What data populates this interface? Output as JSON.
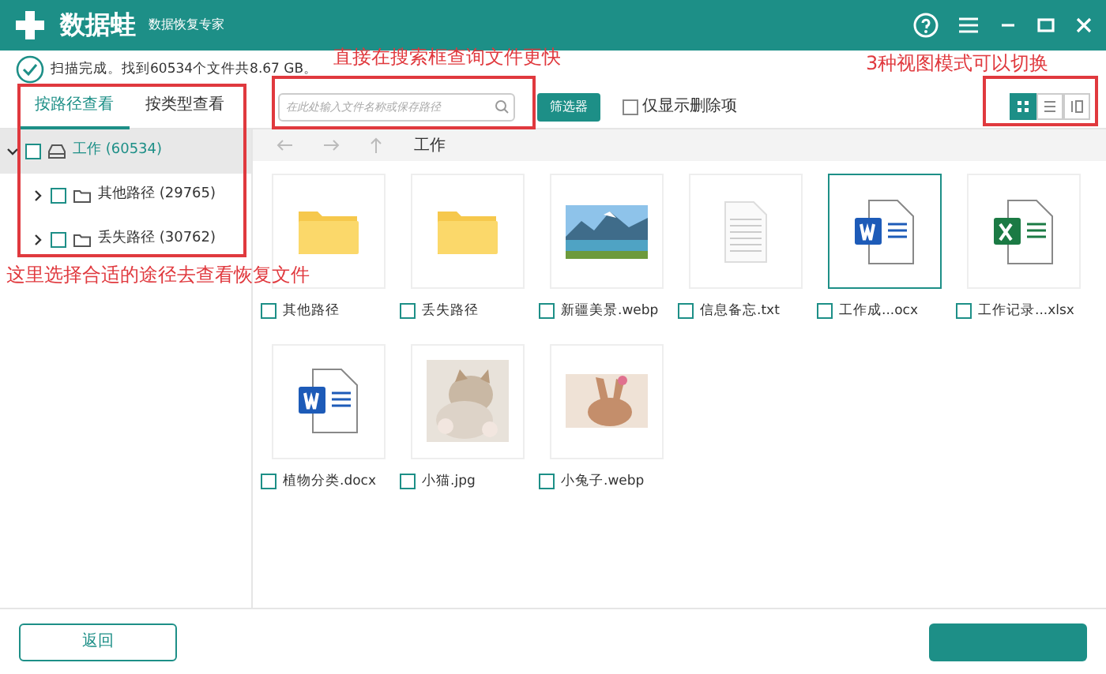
{
  "app": {
    "name": "数据蛙",
    "subtitle": "数据恢复专家"
  },
  "status": "扫描完成。找到60534个文件共8.67 GB。",
  "view_tabs": [
    {
      "label": "按路径查看",
      "selected": true
    },
    {
      "label": "按类型查看",
      "selected": false
    }
  ],
  "search": {
    "placeholder": "在此处输入文件名称或保存路径"
  },
  "filter_button": "筛选器",
  "deleted_only": {
    "label": "仅显示删除项",
    "checked": false
  },
  "view_modes": [
    {
      "kind": "grid",
      "selected": true
    },
    {
      "kind": "list",
      "selected": false
    },
    {
      "kind": "detail",
      "selected": false
    }
  ],
  "tree": [
    {
      "label": "工作 (60534)",
      "kind": "drive",
      "checked": false,
      "expanded": true,
      "selected": true,
      "children": [
        {
          "label": "其他路径 (29765)",
          "kind": "folder",
          "checked": false,
          "expanded": false,
          "selected": false
        },
        {
          "label": "丢失路径 (30762)",
          "kind": "folder",
          "checked": false,
          "expanded": false,
          "selected": false
        }
      ]
    }
  ],
  "breadcrumb": "工作",
  "files": [
    {
      "name": "其他路径",
      "kind": "folder",
      "checked": false,
      "selected": false
    },
    {
      "name": "丢失路径",
      "kind": "folder",
      "checked": false,
      "selected": false
    },
    {
      "name": "新疆美景.webp",
      "kind": "picture",
      "checked": false,
      "selected": false
    },
    {
      "name": "信息备忘.txt",
      "kind": "text",
      "checked": false,
      "selected": false
    },
    {
      "name": "工作成...ocx",
      "kind": "word",
      "checked": false,
      "selected": true
    },
    {
      "name": "工作记录...xlsx",
      "kind": "excel",
      "checked": false,
      "selected": false
    },
    {
      "name": "植物分类.docx",
      "kind": "word",
      "checked": false,
      "selected": false
    },
    {
      "name": "小猫.jpg",
      "kind": "picture",
      "checked": false,
      "selected": false
    },
    {
      "name": "小兔子.webp",
      "kind": "picture",
      "checked": false,
      "selected": false
    }
  ],
  "back_button": "返回",
  "annotations": [
    "直接在搜索框查询文件更快",
    "3种视图模式可以切换",
    "这里选择合适的途径去查看恢复文件"
  ]
}
